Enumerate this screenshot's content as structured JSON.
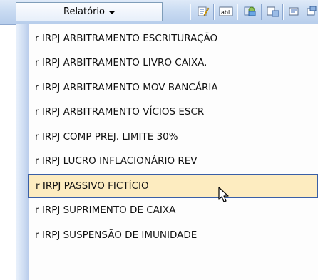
{
  "toolbar": {
    "report_dropdown_label": "Relatório",
    "icons": [
      "edit-icon",
      "text-field-icon",
      "form-object-icon",
      "command-button-icon"
    ]
  },
  "menu": {
    "items": [
      "r IRPJ ARBITRAMENTO ESCRITURAÇÃO",
      "r IRPJ ARBITRAMENTO LIVRO CAIXA.",
      "r IRPJ ARBITRAMENTO MOV BANCÁRIA",
      "r IRPJ ARBITRAMENTO VÍCIOS ESCR",
      "r IRPJ COMP PREJ. LIMITE 30%",
      "r IRPJ LUCRO INFLACIONÁRIO REV",
      "r IRPJ PASSIVO FICTÍCIO",
      "r IRPJ SUPRIMENTO DE CAIXA",
      "r IRPJ SUSPENSÃO DE IMUNIDADE"
    ],
    "highlighted_index": 6
  },
  "colors": {
    "highlight_bg": "#fdecc0",
    "highlight_border": "#3a5fa6",
    "toolbar_bg": "#c9dbf2"
  }
}
